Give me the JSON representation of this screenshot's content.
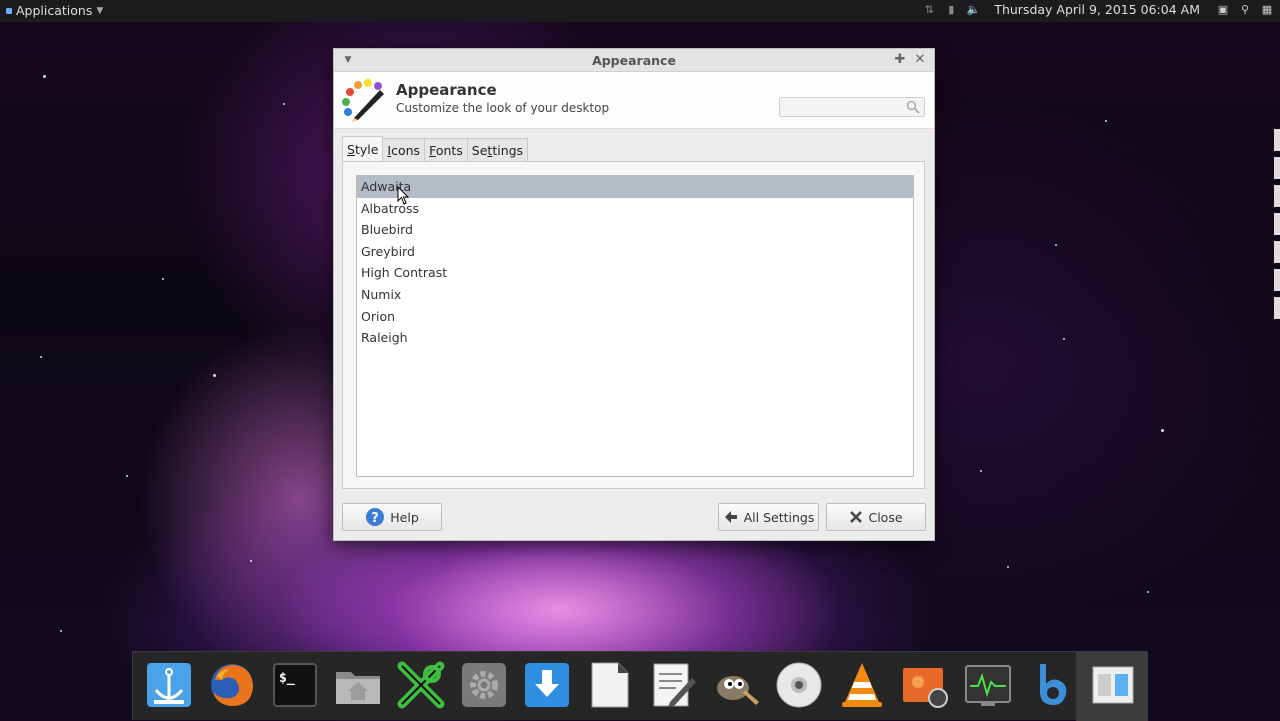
{
  "top_panel": {
    "apps_label": "Applications",
    "clock": "Thursday April  9, 2015 06:04 AM",
    "tray_icons": [
      "network-icon",
      "battery-icon",
      "volume-icon",
      "window-icon",
      "search-icon",
      "screenshot-icon"
    ]
  },
  "window": {
    "title": "Appearance",
    "header_title": "Appearance",
    "header_subtitle": "Customize the look of your desktop",
    "search_value": "",
    "search_placeholder": "",
    "tabs": [
      {
        "pre": "",
        "u": "S",
        "post": "tyle"
      },
      {
        "pre": "",
        "u": "I",
        "post": "cons"
      },
      {
        "pre": "",
        "u": "F",
        "post": "onts"
      },
      {
        "pre": "Se",
        "u": "t",
        "post": "tings"
      }
    ],
    "selected_tab": "Style",
    "themes": [
      "Adwaita",
      "Albatross",
      "Bluebird",
      "Greybird",
      "High Contrast",
      "Numix",
      "Orion",
      "Raleigh"
    ],
    "selected_theme": "Adwaita",
    "help_label": "Help",
    "all_settings_label": "All Settings",
    "close_label": "Close"
  },
  "dock": {
    "items": [
      "anchor-icon",
      "firefox-icon",
      "terminal-icon",
      "home-folder-icon",
      "xarchiver-icon",
      "settings-icon",
      "download-icon",
      "document-icon",
      "text-editor-icon",
      "gimp-icon",
      "disc-icon",
      "vlc-icon",
      "photo-icon",
      "system-monitor-icon",
      "bluefish-icon",
      "workspace-switcher-icon"
    ]
  },
  "colors": {
    "selected_row": "#b4bcc6",
    "panel_bg": "#1c1c1e",
    "dock_bg": "#262626"
  }
}
